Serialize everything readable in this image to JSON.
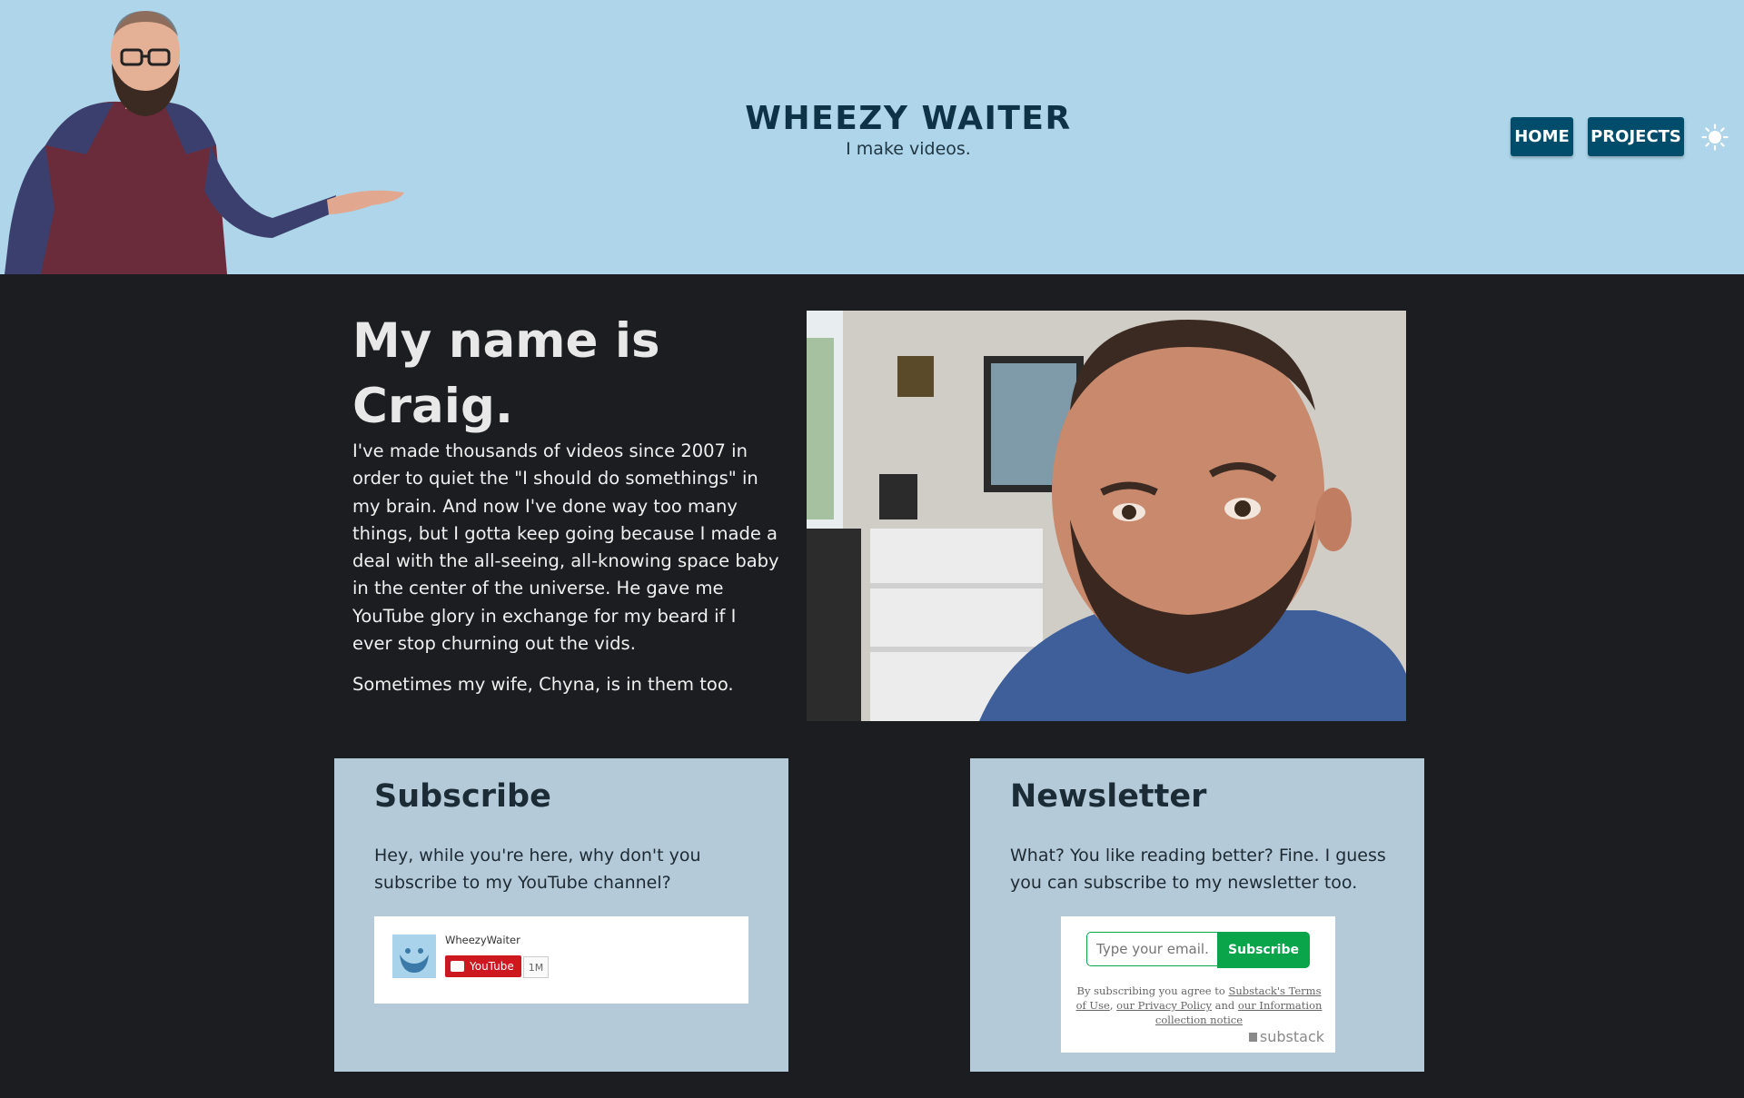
{
  "header": {
    "title": "WHEEZY WAITER",
    "subtitle": "I make videos.",
    "nav": {
      "home_label": "HOME",
      "projects_label": "PROJECTS"
    },
    "theme_icon": "sun-icon"
  },
  "intro": {
    "heading": "My name is Craig.",
    "paragraph1": "I've made thousands of videos since 2007 in order to quiet the \"I should do somethings\" in my brain. And now I've done way too many things, but I gotta keep going because I made a deal with the all-seeing, all-knowing space baby in the center of the universe. He gave me YouTube glory in exchange for my beard if I ever stop churning out the vids.",
    "paragraph2": "Sometimes my wife, Chyna, is in them too."
  },
  "subscribe_card": {
    "title": "Subscribe",
    "text": "Hey, while you're here, why don't you subscribe to my YouTube channel?",
    "widget": {
      "channel_name": "WheezyWaiter",
      "button_label": "YouTube",
      "subscriber_count": "1M"
    }
  },
  "newsletter_card": {
    "title": "Newsletter",
    "text": "What? You like reading better? Fine. I guess you can subscribe to my newsletter too.",
    "widget": {
      "email_placeholder": "Type your email...",
      "button_label": "Subscribe",
      "legal_prefix": "By subscribing you agree to ",
      "terms_link": "Substack's Terms of Use",
      "legal_sep1": ", ",
      "privacy_link": "our Privacy Policy",
      "legal_sep2": " and ",
      "info_link": "our Information collection notice",
      "brand": "substack"
    }
  },
  "colors": {
    "header_bg": "#aed5ea",
    "page_bg": "#1c1d20",
    "nav_button": "#004d6b",
    "card_bg": "#b5cad8",
    "substack_green": "#0aa44a",
    "youtube_red": "#cc181e"
  }
}
